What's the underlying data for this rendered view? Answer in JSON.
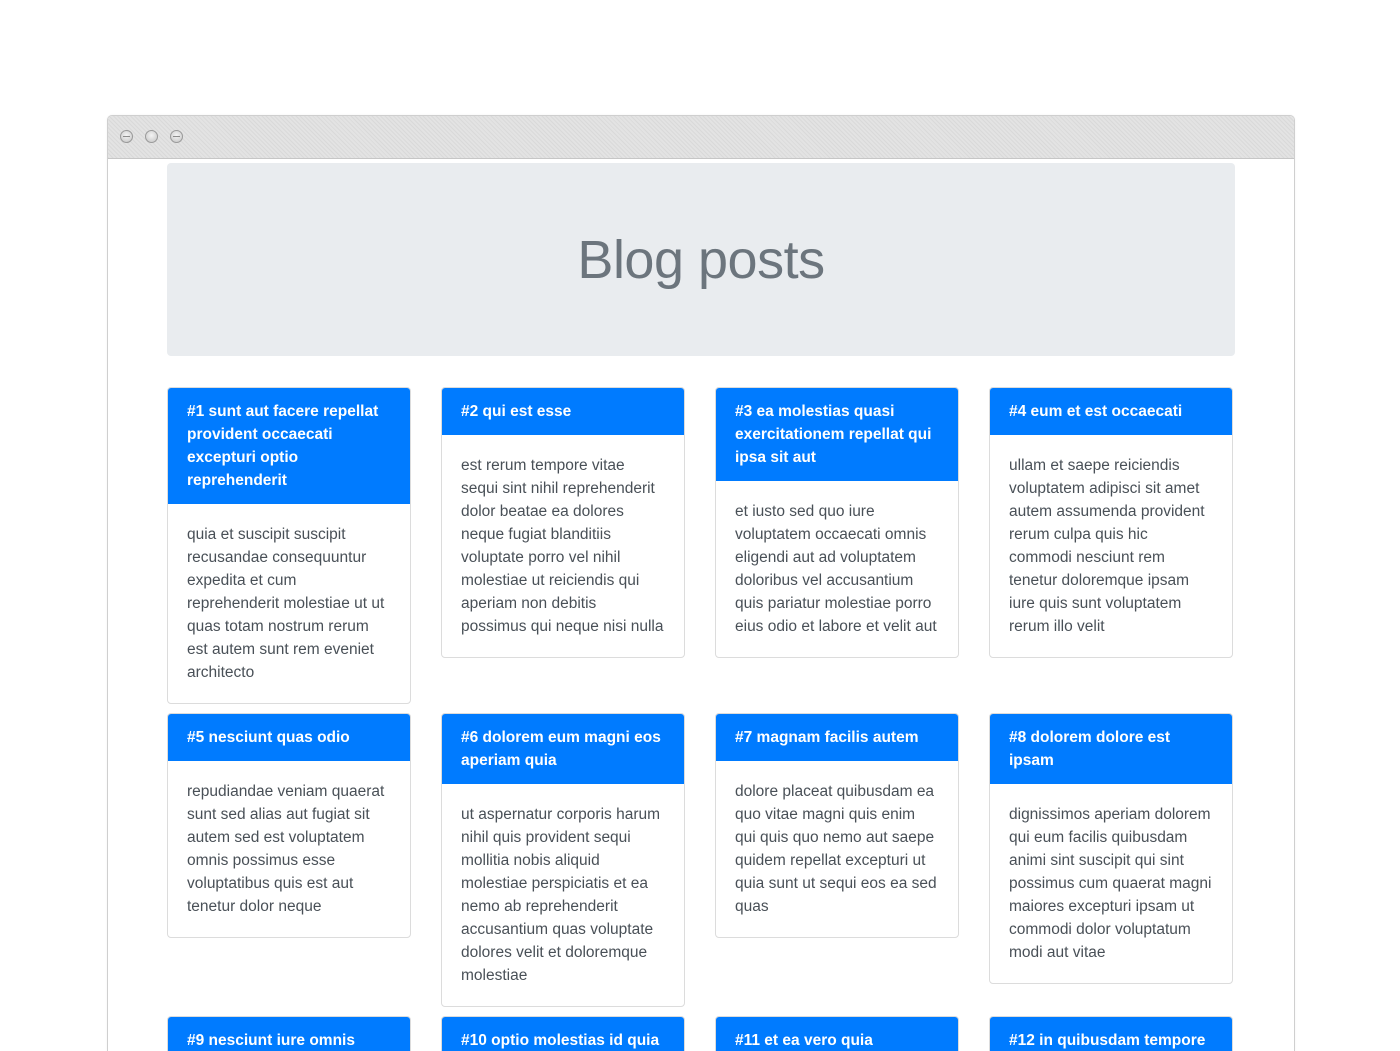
{
  "header": {
    "title": "Blog posts"
  },
  "posts": [
    {
      "title": "#1 sunt aut facere repellat provident occaecati excepturi optio reprehenderit",
      "body": "quia et suscipit suscipit recusandae consequuntur expedita et cum reprehenderit molestiae ut ut quas totam nostrum rerum est autem sunt rem eveniet architecto"
    },
    {
      "title": "#2 qui est esse",
      "body": "est rerum tempore vitae sequi sint nihil reprehenderit dolor beatae ea dolores neque fugiat blanditiis voluptate porro vel nihil molestiae ut reiciendis qui aperiam non debitis possimus qui neque nisi nulla"
    },
    {
      "title": "#3 ea molestias quasi exercitationem repellat qui ipsa sit aut",
      "body": "et iusto sed quo iure voluptatem occaecati omnis eligendi aut ad voluptatem doloribus vel accusantium quis pariatur molestiae porro eius odio et labore et velit aut"
    },
    {
      "title": "#4 eum et est occaecati",
      "body": "ullam et saepe reiciendis voluptatem adipisci sit amet autem assumenda provident rerum culpa quis hic commodi nesciunt rem tenetur doloremque ipsam iure quis sunt voluptatem rerum illo velit"
    },
    {
      "title": "#5 nesciunt quas odio",
      "body": "repudiandae veniam quaerat sunt sed alias aut fugiat sit autem sed est voluptatem omnis possimus esse voluptatibus quis est aut tenetur dolor neque"
    },
    {
      "title": "#6 dolorem eum magni eos aperiam quia",
      "body": "ut aspernatur corporis harum nihil quis provident sequi mollitia nobis aliquid molestiae perspiciatis et ea nemo ab reprehenderit accusantium quas voluptate dolores velit et doloremque molestiae"
    },
    {
      "title": "#7 magnam facilis autem",
      "body": "dolore placeat quibusdam ea quo vitae magni quis enim qui quis quo nemo aut saepe quidem repellat excepturi ut quia sunt ut sequi eos ea sed quas"
    },
    {
      "title": "#8 dolorem dolore est ipsam",
      "body": "dignissimos aperiam dolorem qui eum facilis quibusdam animi sint suscipit qui sint possimus cum quaerat magni maiores excepturi ipsam ut commodi dolor voluptatum modi aut vitae"
    },
    {
      "title": "#9 nesciunt iure omnis",
      "body": ""
    },
    {
      "title": "#10 optio molestias id quia",
      "body": ""
    },
    {
      "title": "#11 et ea vero quia",
      "body": ""
    },
    {
      "title": "#12 in quibusdam tempore",
      "body": ""
    }
  ],
  "colors": {
    "accent": "#007bff",
    "jumbotron_bg": "#e9ecef",
    "title_text": "#6c757d",
    "body_text": "#495057"
  }
}
